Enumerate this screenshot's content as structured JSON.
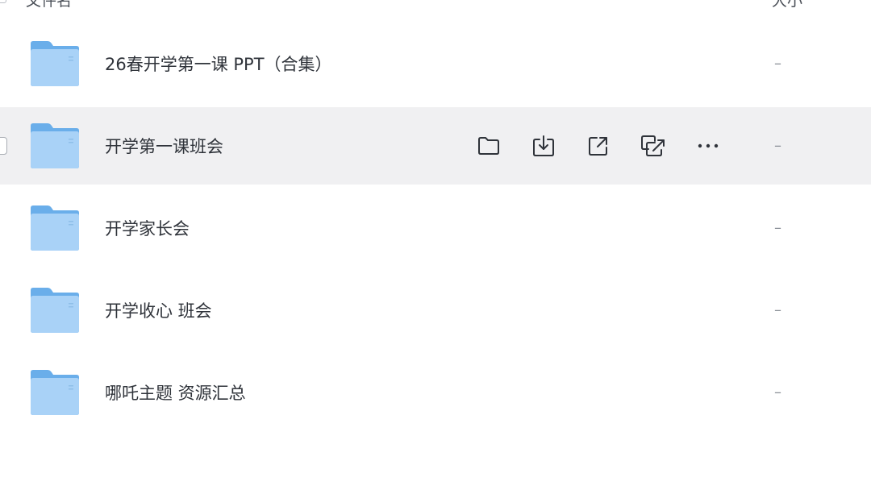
{
  "header": {
    "name_label": "文件名",
    "size_label": "大小"
  },
  "files": [
    {
      "name": "26春开学第一课 PPT（合集）",
      "size": "–",
      "icon": "folder-icon"
    },
    {
      "name": "开学第一课班会",
      "size": "–",
      "icon": "folder-icon"
    },
    {
      "name": "开学家长会",
      "size": "–",
      "icon": "folder-icon"
    },
    {
      "name": "开学收心 班会",
      "size": "–",
      "icon": "folder-icon"
    },
    {
      "name": "哪吒主题 资源汇总",
      "size": "–",
      "icon": "folder-icon"
    }
  ],
  "row_actions": [
    {
      "icon": "open-folder-icon"
    },
    {
      "icon": "download-icon"
    },
    {
      "icon": "share-icon"
    },
    {
      "icon": "copy-link-icon"
    },
    {
      "icon": "more-icon"
    }
  ],
  "colors": {
    "folder_back": "#6aaeea",
    "folder_front": "#a9d2f7",
    "hover_row": "#f0f0f2",
    "text": "#2f333a"
  }
}
